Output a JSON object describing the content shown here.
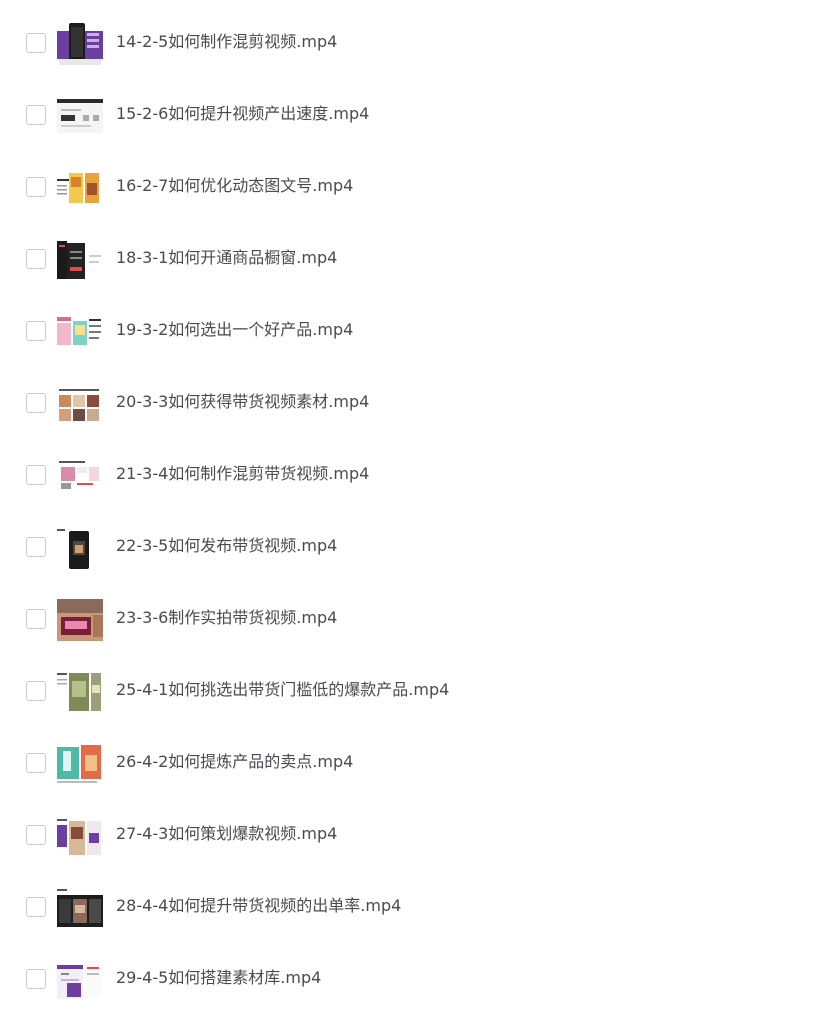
{
  "files": [
    {
      "name": "14-2-5如何制作混剪视频.mp4",
      "icon": "video-thumbnail-icon",
      "checked": false
    },
    {
      "name": "15-2-6如何提升视频产出速度.mp4",
      "icon": "video-thumbnail-icon",
      "checked": false
    },
    {
      "name": "16-2-7如何优化动态图文号.mp4",
      "icon": "video-thumbnail-icon",
      "checked": false
    },
    {
      "name": "18-3-1如何开通商品橱窗.mp4",
      "icon": "video-thumbnail-icon",
      "checked": false
    },
    {
      "name": "19-3-2如何选出一个好产品.mp4",
      "icon": "video-thumbnail-icon",
      "checked": false
    },
    {
      "name": "20-3-3如何获得带货视频素材.mp4",
      "icon": "video-thumbnail-icon",
      "checked": false
    },
    {
      "name": "21-3-4如何制作混剪带货视频.mp4",
      "icon": "video-thumbnail-icon",
      "checked": false
    },
    {
      "name": "22-3-5如何发布带货视频.mp4",
      "icon": "video-thumbnail-icon",
      "checked": false
    },
    {
      "name": "23-3-6制作实拍带货视频.mp4",
      "icon": "video-thumbnail-icon",
      "checked": false
    },
    {
      "name": "25-4-1如何挑选出带货门槛低的爆款产品.mp4",
      "icon": "video-thumbnail-icon",
      "checked": false
    },
    {
      "name": "26-4-2如何提炼产品的卖点.mp4",
      "icon": "video-thumbnail-icon",
      "checked": false
    },
    {
      "name": "27-4-3如何策划爆款视频.mp4",
      "icon": "video-thumbnail-icon",
      "checked": false
    },
    {
      "name": "28-4-4如何提升带货视频的出单率.mp4",
      "icon": "video-thumbnail-icon",
      "checked": false
    },
    {
      "name": "29-4-5如何搭建素材库.mp4",
      "icon": "video-thumbnail-icon",
      "checked": false
    }
  ],
  "colors": {
    "text": "#4a4a52",
    "checkbox_border": "#c9c9cf",
    "accent_purple": "#6b3fa0"
  }
}
